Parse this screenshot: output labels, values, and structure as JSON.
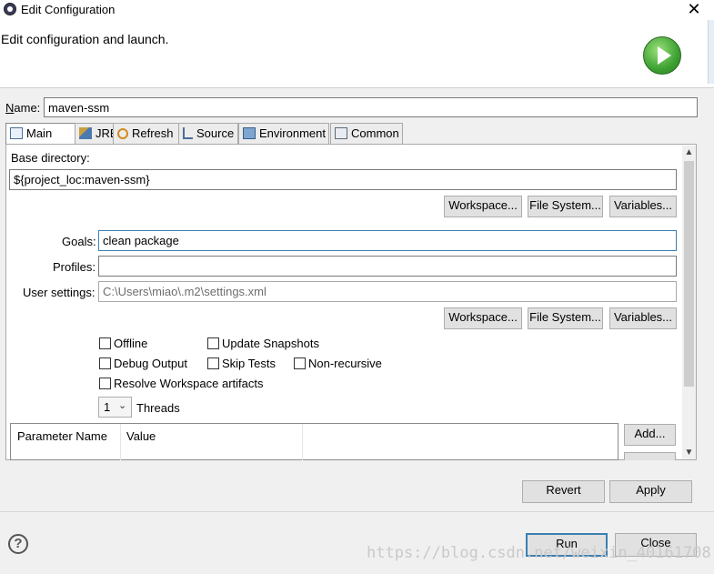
{
  "window": {
    "title": "Edit Configuration",
    "close_glyph": "✕"
  },
  "header": {
    "text": "Edit configuration and launch."
  },
  "name": {
    "label": "Name:",
    "value": "maven-ssm"
  },
  "tabs": [
    {
      "label": "Main",
      "icon": "main-tab-icon"
    },
    {
      "label": "JRE",
      "icon": "jre-icon"
    },
    {
      "label": "Refresh",
      "icon": "refresh-icon"
    },
    {
      "label": "Source",
      "icon": "source-icon"
    },
    {
      "label": "Environment",
      "icon": "environment-icon"
    },
    {
      "label": "Common",
      "icon": "common-icon"
    }
  ],
  "main": {
    "base_dir_label": "Base directory:",
    "base_dir_value": "${project_loc:maven-ssm}",
    "buttons_row1": {
      "workspace": "Workspace...",
      "filesystem": "File System...",
      "variables": "Variables..."
    },
    "goals_label": "Goals:",
    "goals_value": "clean package",
    "profiles_label": "Profiles:",
    "profiles_value": "",
    "user_settings_label": "User settings:",
    "user_settings_value": "C:\\Users\\miao\\.m2\\settings.xml",
    "buttons_row2": {
      "workspace": "Workspace...",
      "filesystem": "File System...",
      "variables": "Variables..."
    },
    "options": {
      "offline": "Offline",
      "update_snapshots": "Update Snapshots",
      "debug_output": "Debug Output",
      "skip_tests": "Skip Tests",
      "non_recursive": "Non-recursive",
      "resolve_workspace": "Resolve Workspace artifacts"
    },
    "threads_value": "1",
    "threads_label": "Threads",
    "table": {
      "col_name": "Parameter Name",
      "col_value": "Value"
    },
    "add_button": "Add..."
  },
  "actions": {
    "revert": "Revert",
    "apply": "Apply",
    "run": "Run",
    "close": "Close"
  },
  "watermark": "https://blog.csdn.net/weixin_40161708"
}
